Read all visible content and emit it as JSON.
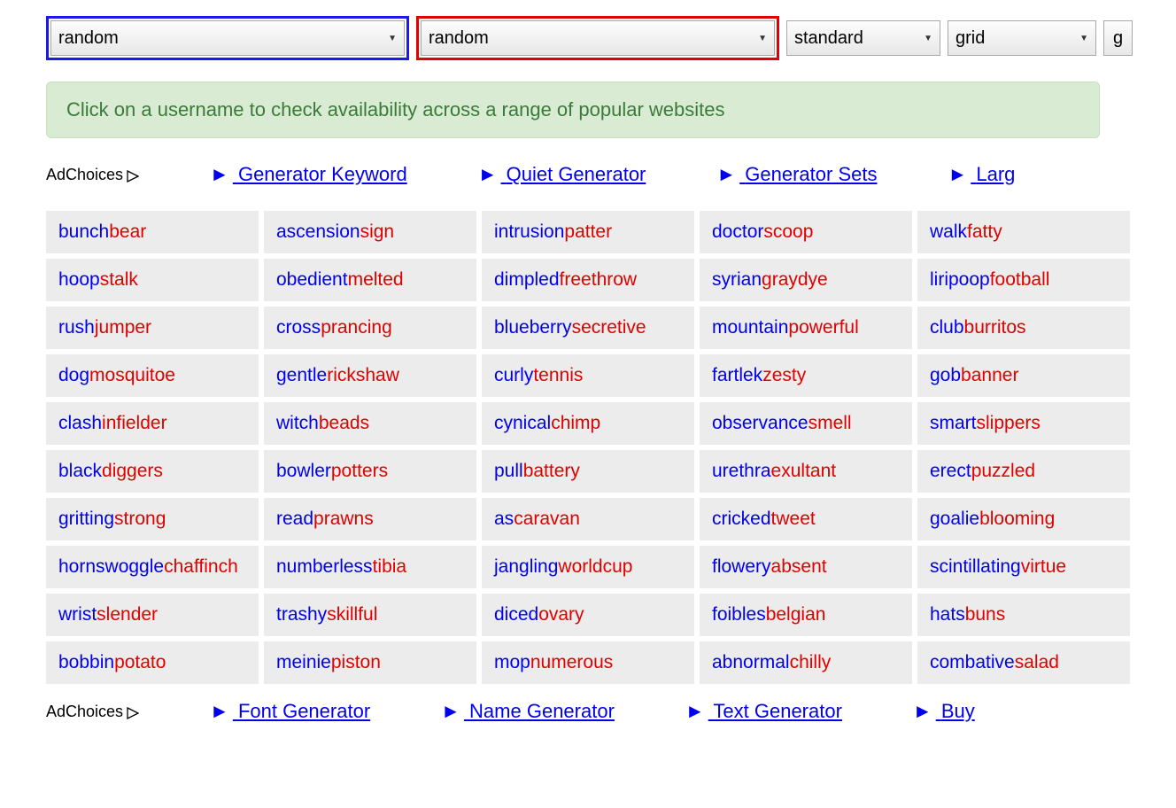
{
  "controls": {
    "select1": "random",
    "select2": "random",
    "select3": "standard",
    "select4": "grid",
    "go": "g"
  },
  "banner": "Click on a username to check availability across a range of popular websites",
  "adchoices_label": "AdChoices",
  "ads_top": [
    "Generator Keyword",
    "Quiet Generator",
    "Generator Sets",
    "Larg"
  ],
  "ads_bottom": [
    "Font Generator",
    "Name Generator",
    "Text Generator",
    "Buy"
  ],
  "usernames": [
    [
      [
        "bunch",
        "bear"
      ],
      [
        "ascension",
        "sign"
      ],
      [
        "intrusion",
        "patter"
      ],
      [
        "doctor",
        "scoop"
      ],
      [
        "walk",
        "fatty"
      ]
    ],
    [
      [
        "hoop",
        "stalk"
      ],
      [
        "obedient",
        "melted"
      ],
      [
        "dimpled",
        "freethrow"
      ],
      [
        "syrian",
        "graydye"
      ],
      [
        "liripoop",
        "football"
      ]
    ],
    [
      [
        "rush",
        "jumper"
      ],
      [
        "cross",
        "prancing"
      ],
      [
        "blueberry",
        "secretive"
      ],
      [
        "mountain",
        "powerful"
      ],
      [
        "club",
        "burritos"
      ]
    ],
    [
      [
        "dog",
        "mosquitoe"
      ],
      [
        "gentle",
        "rickshaw"
      ],
      [
        "curly",
        "tennis"
      ],
      [
        "fartlek",
        "zesty"
      ],
      [
        "gob",
        "banner"
      ]
    ],
    [
      [
        "clash",
        "infielder"
      ],
      [
        "witch",
        "beads"
      ],
      [
        "cynical",
        "chimp"
      ],
      [
        "observance",
        "smell"
      ],
      [
        "smart",
        "slippers"
      ]
    ],
    [
      [
        "black",
        "diggers"
      ],
      [
        "bowler",
        "potters"
      ],
      [
        "pull",
        "battery"
      ],
      [
        "urethra",
        "exultant"
      ],
      [
        "erect",
        "puzzled"
      ]
    ],
    [
      [
        "gritting",
        "strong"
      ],
      [
        "read",
        "prawns"
      ],
      [
        "as",
        "caravan"
      ],
      [
        "cricked",
        "tweet"
      ],
      [
        "goalie",
        "blooming"
      ]
    ],
    [
      [
        "hornswoggle",
        "chaffinch"
      ],
      [
        "numberless",
        "tibia"
      ],
      [
        "jangling",
        "worldcup"
      ],
      [
        "flowery",
        "absent"
      ],
      [
        "scintillating",
        "virtue"
      ]
    ],
    [
      [
        "wrist",
        "slender"
      ],
      [
        "trashy",
        "skillful"
      ],
      [
        "diced",
        "ovary"
      ],
      [
        "foibles",
        "belgian"
      ],
      [
        "hats",
        "buns"
      ]
    ],
    [
      [
        "bobbin",
        "potato"
      ],
      [
        "meinie",
        "piston"
      ],
      [
        "mop",
        "numerous"
      ],
      [
        "abnormal",
        "chilly"
      ],
      [
        "combative",
        "salad"
      ]
    ]
  ]
}
